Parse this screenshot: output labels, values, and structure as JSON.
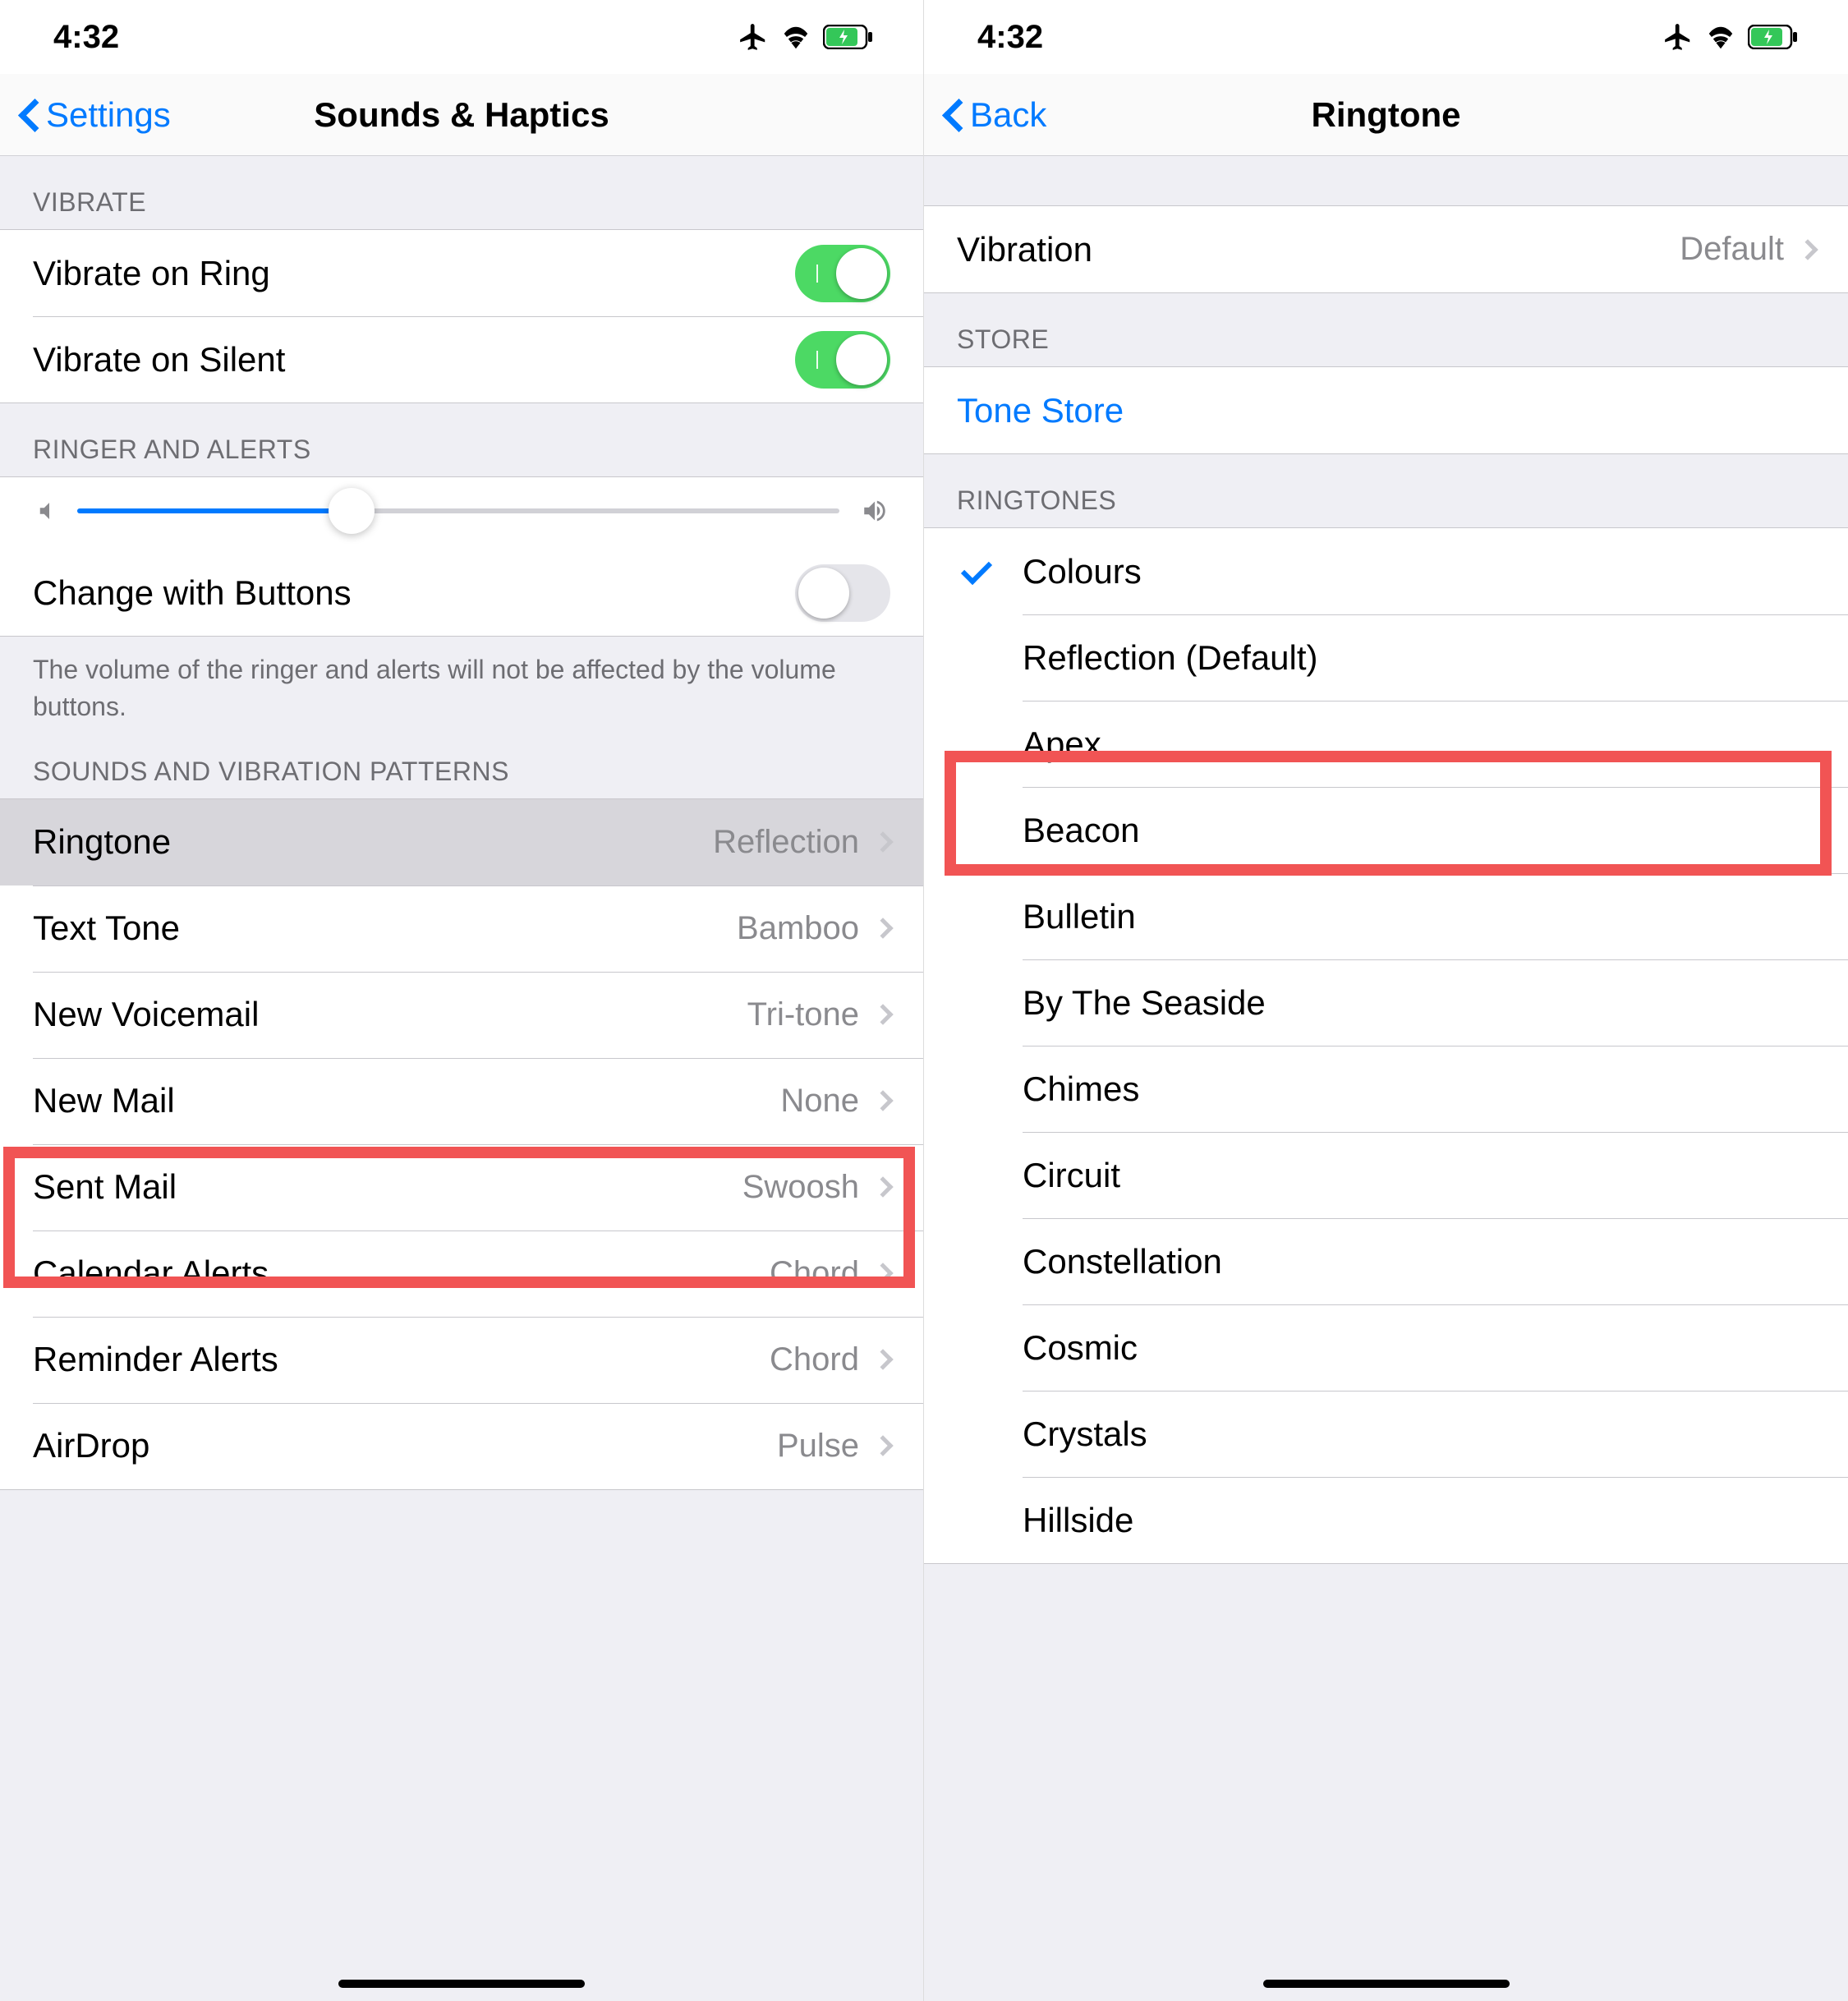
{
  "status": {
    "time": "4:32"
  },
  "left": {
    "back_label": "Settings",
    "title": "Sounds & Haptics",
    "vibrate_header": "VIBRATE",
    "vibrate_ring": "Vibrate on Ring",
    "vibrate_silent": "Vibrate on Silent",
    "ringer_header": "RINGER AND ALERTS",
    "change_buttons": "Change with Buttons",
    "change_buttons_footer": "The volume of the ringer and alerts will not be affected by the volume buttons.",
    "patterns_header": "SOUNDS AND VIBRATION PATTERNS",
    "rows": {
      "ringtone": {
        "label": "Ringtone",
        "value": "Reflection"
      },
      "texttone": {
        "label": "Text Tone",
        "value": "Bamboo"
      },
      "voicemail": {
        "label": "New Voicemail",
        "value": "Tri-tone"
      },
      "newmail": {
        "label": "New Mail",
        "value": "None"
      },
      "sentmail": {
        "label": "Sent Mail",
        "value": "Swoosh"
      },
      "calendar": {
        "label": "Calendar Alerts",
        "value": "Chord"
      },
      "reminder": {
        "label": "Reminder Alerts",
        "value": "Chord"
      },
      "airdrop": {
        "label": "AirDrop",
        "value": "Pulse"
      }
    }
  },
  "right": {
    "back_label": "Back",
    "title": "Ringtone",
    "vibration_label": "Vibration",
    "vibration_value": "Default",
    "store_header": "STORE",
    "tone_store": "Tone Store",
    "ringtones_header": "RINGTONES",
    "items": {
      "0": "Colours",
      "1": "Reflection (Default)",
      "2": "Apex",
      "3": "Beacon",
      "4": "Bulletin",
      "5": "By The Seaside",
      "6": "Chimes",
      "7": "Circuit",
      "8": "Constellation",
      "9": "Cosmic",
      "10": "Crystals",
      "11": "Hillside"
    }
  }
}
